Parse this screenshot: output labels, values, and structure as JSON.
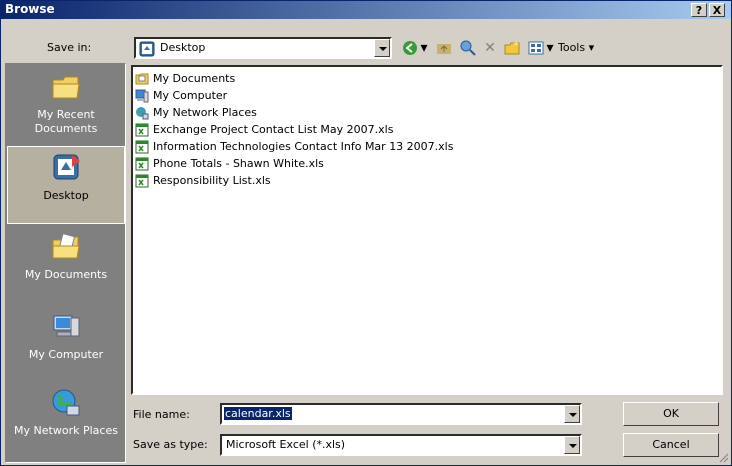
{
  "window": {
    "title": "Browse",
    "help": "?",
    "close": "X"
  },
  "toolbar": {
    "save_in_label": "Save in:",
    "save_in_value": "Desktop",
    "tools_label": "Tools",
    "icons": [
      "back-icon",
      "up-folder-icon",
      "search-web-icon",
      "delete-icon",
      "new-folder-icon",
      "views-icon"
    ]
  },
  "places": [
    {
      "label": "My Recent Documents",
      "icon": "recent-documents-icon",
      "selected": false
    },
    {
      "label": "Desktop",
      "icon": "desktop-icon",
      "selected": true
    },
    {
      "label": "My Documents",
      "icon": "my-documents-icon",
      "selected": false
    },
    {
      "label": "My Computer",
      "icon": "my-computer-icon",
      "selected": false
    },
    {
      "label": "My Network Places",
      "icon": "network-places-icon",
      "selected": false
    }
  ],
  "files": [
    {
      "name": "My Documents",
      "icon": "folder-icon"
    },
    {
      "name": "My Computer",
      "icon": "computer-icon"
    },
    {
      "name": "My Network Places",
      "icon": "network-icon"
    },
    {
      "name": "Exchange Project Contact List May 2007.xls",
      "icon": "excel-file-icon"
    },
    {
      "name": "Information Technologies Contact Info Mar 13 2007.xls",
      "icon": "excel-file-icon"
    },
    {
      "name": "Phone Totals - Shawn White.xls",
      "icon": "excel-file-icon"
    },
    {
      "name": "Responsibility List.xls",
      "icon": "excel-file-icon"
    }
  ],
  "footer": {
    "file_name_label": "File name:",
    "file_name_value": "calendar.xls",
    "save_as_type_label": "Save as type:",
    "save_as_type_value": "Microsoft Excel (*.xls)",
    "ok_label": "OK",
    "cancel_label": "Cancel"
  },
  "colors": {
    "titlebar": "#0a246a",
    "face": "#d4d0c8",
    "selection": "#0a246a"
  }
}
